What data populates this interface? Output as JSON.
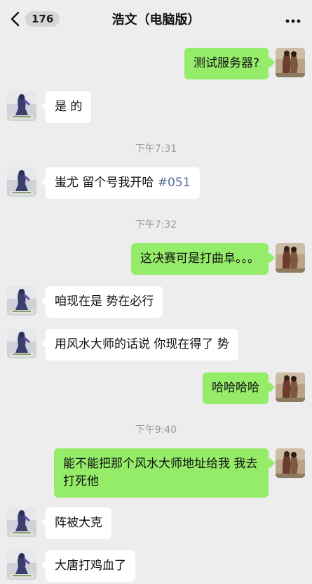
{
  "header": {
    "unread_count": "176",
    "title": "浩文（电脑版）",
    "back_icon": "chevron-left",
    "more_icon": "more-dots"
  },
  "messages": [
    {
      "side": "out",
      "text": "测试服务器?"
    },
    {
      "side": "in",
      "text": "是 的"
    },
    {
      "time": "下午7:31"
    },
    {
      "side": "in",
      "text": "蚩尤  留个号我开哈",
      "tag": "#051"
    },
    {
      "time": "下午7:32"
    },
    {
      "side": "out",
      "text": "这决赛可是打曲阜。。。"
    },
    {
      "side": "in",
      "text": "咱现在是  势在必行"
    },
    {
      "side": "in",
      "text": "用风水大师的话说  你现在得了 势"
    },
    {
      "side": "out",
      "text": "哈哈哈哈"
    },
    {
      "time": "下午9:40"
    },
    {
      "side": "out",
      "text": "能不能把那个风水大师地址给我 我去打死他"
    },
    {
      "side": "in",
      "text": "阵被大克"
    },
    {
      "side": "in",
      "text": "大唐打鸡血了"
    }
  ],
  "colors": {
    "background": "#ededed",
    "outgoing_bubble": "#95ec69",
    "incoming_bubble": "#ffffff",
    "hashtag": "#576b95",
    "timestamp": "#999999"
  }
}
